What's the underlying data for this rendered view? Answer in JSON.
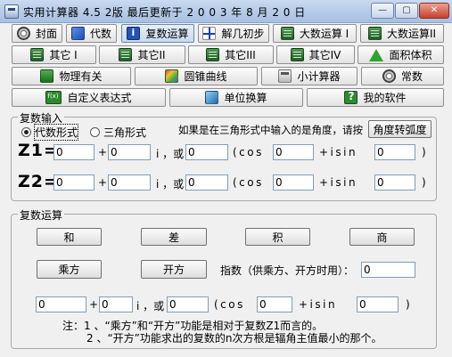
{
  "window": {
    "title": "实用计算器 4.5 2版  最后更新于 2 0 0 3 年 8 月 2 0 日",
    "minimize": "—",
    "maximize": "▢",
    "close": "✕"
  },
  "toolbar": {
    "row1": [
      {
        "label": "封面",
        "icon": "swirl-icon"
      },
      {
        "label": "代数",
        "icon": "cube-icon"
      },
      {
        "label": "复数运算",
        "icon": "info-icon"
      },
      {
        "label": "解几初步",
        "icon": "axes-icon"
      },
      {
        "label": "大数运算 I",
        "icon": "board-icon"
      },
      {
        "label": "大数运算II",
        "icon": "board-icon"
      }
    ],
    "row2": [
      {
        "label": "其它 I",
        "icon": "board-icon"
      },
      {
        "label": "其它II",
        "icon": "board-icon"
      },
      {
        "label": "其它III",
        "icon": "board-icon"
      },
      {
        "label": "其它IV",
        "icon": "board-icon"
      },
      {
        "label": "面积体积",
        "icon": "triangle-icon"
      }
    ],
    "row3": [
      {
        "label": "物理有关",
        "icon": "leaf-icon"
      },
      {
        "label": "圆锥曲线",
        "icon": "rainbow-icon"
      },
      {
        "label": "小计算器",
        "icon": "calculator-icon"
      },
      {
        "label": "常数",
        "icon": "swirl-icon"
      }
    ],
    "row4": [
      {
        "label": "自定义表达式",
        "icon": "fx-icon"
      },
      {
        "label": "单位换算",
        "icon": "cube-icon"
      },
      {
        "label": "我的软件",
        "icon": "question-icon"
      }
    ]
  },
  "input_group": {
    "title": "复数输入",
    "radio_algebraic": "代数形式",
    "radio_trig": "三角形式",
    "hint": "如果是在三角形式中输入的是角度，请按",
    "convert_button": "角度转弧度",
    "z1_label": "Z1=",
    "z2_label": "Z2=",
    "plus": "+",
    "i_or": "i ，或",
    "cos_open": "(cos",
    "plus_isin": "+isin",
    "close_paren": ")",
    "z1": {
      "real": "0",
      "imag": "0",
      "mod": "0",
      "cos": "0",
      "sin": "0"
    },
    "z2": {
      "real": "0",
      "imag": "0",
      "mod": "0",
      "cos": "0",
      "sin": "0"
    }
  },
  "ops_group": {
    "title": "复数运算",
    "add": "和",
    "sub": "差",
    "mul": "积",
    "div": "商",
    "power": "乘方",
    "root": "开方",
    "exp_label": "指数（供乘方、开方时用）：",
    "exp_value": "0",
    "result": {
      "real": "0",
      "imag": "0",
      "mod": "0",
      "cos": "0",
      "sin": "0"
    },
    "plus": "+",
    "i_or": "i ，或",
    "cos_open": "(cos",
    "plus_isin": "+isin",
    "close_paren": ")",
    "note1": "注：1 、“乘方”和“开方”功能是相对于复数Z1而言的。",
    "note2": "2 、“开方”功能求出的复数的n次方根是辐角主值最小的那个。"
  }
}
